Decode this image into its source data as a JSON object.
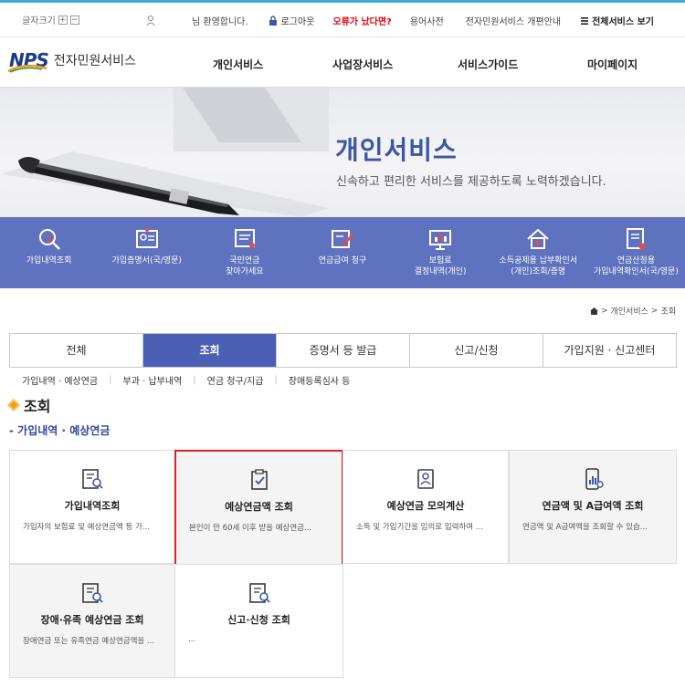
{
  "util": {
    "font_size_label": "글자크기",
    "font_plus": "+",
    "font_minus": "−",
    "welcome": "님 환영합니다.",
    "logout": "로그아웃",
    "error_report": "오류가 났다면?",
    "dictionary": "용어사전",
    "renewal_guide": "전자민원서비스 개편안내",
    "all_services": "전체서비스 보기"
  },
  "header": {
    "logo_mark": "NPS",
    "logo_text": "전자민원서비스",
    "nav": [
      "개인서비스",
      "사업장서비스",
      "서비스가이드",
      "마이페이지"
    ]
  },
  "banner": {
    "title": "개인서비스",
    "subtitle": "신속하고 편리한 서비스를 제공하도록 노력하겠습니다."
  },
  "quick_menu": [
    {
      "line1": "가입내역조회",
      "line2": "",
      "icon": "search-icon"
    },
    {
      "line1": "가입증명서(국/영문)",
      "line2": "",
      "icon": "certificate-icon"
    },
    {
      "line1": "국민연금",
      "line2": "찾아가세요",
      "icon": "document-icon"
    },
    {
      "line1": "연금급여 청구",
      "line2": "",
      "icon": "edit-icon"
    },
    {
      "line1": "보험료",
      "line2": "결정내역(개인)",
      "icon": "monitor-icon"
    },
    {
      "line1": "소득공제용 납부확인서",
      "line2": "(개인)조회/증명",
      "icon": "house-icon"
    },
    {
      "line1": "연금산정용",
      "line2": "가입내역확인서(국/영문)",
      "icon": "document-check-icon"
    }
  ],
  "breadcrumb": [
    "개인서비스",
    "조회"
  ],
  "tabs": [
    "전체",
    "조회",
    "증명서 등 발급",
    "신고/신청",
    "가입지원 · 신고센터"
  ],
  "active_tab": "조회",
  "subtabs": [
    "가입내역 · 예상연금",
    "부과 · 납부내역",
    "연금 청구/지급",
    "장애등록심사 등"
  ],
  "section_title": "조회",
  "subsection_title": "가입내역 · 예상연금",
  "cards": [
    {
      "title": "가입내역조회",
      "desc": "가입자의 보험료 및 예상연금액 등 가...",
      "icon": "document-search-icon"
    },
    {
      "title": "예상연금액 조회",
      "desc": "본인이 만 60세 이후 받을 예상연금...",
      "icon": "clipboard-check-icon"
    },
    {
      "title": "예상연금 모의계산",
      "desc": "소득 및 가입기간을 임의로 입력하여 ...",
      "icon": "id-card-icon"
    },
    {
      "title": "연금액 및 A급여액 조회",
      "desc": "연금액 및 A급여액을 조회할 수 있습...",
      "icon": "phone-chart-icon"
    },
    {
      "title": "장애·유족 예상연금 조회",
      "desc": "장애연금 또는 유족연금 예상연금액을 ...",
      "icon": "document-search-icon"
    },
    {
      "title": "신고·신청 조회",
      "desc": "...",
      "icon": "document-search-icon"
    }
  ],
  "colors": {
    "brand_blue": "#4b5fb5",
    "quick_bg": "#5f72bf",
    "error_red": "#e60012",
    "highlight_red": "#e02020",
    "accent_orange": "#e69e21"
  }
}
